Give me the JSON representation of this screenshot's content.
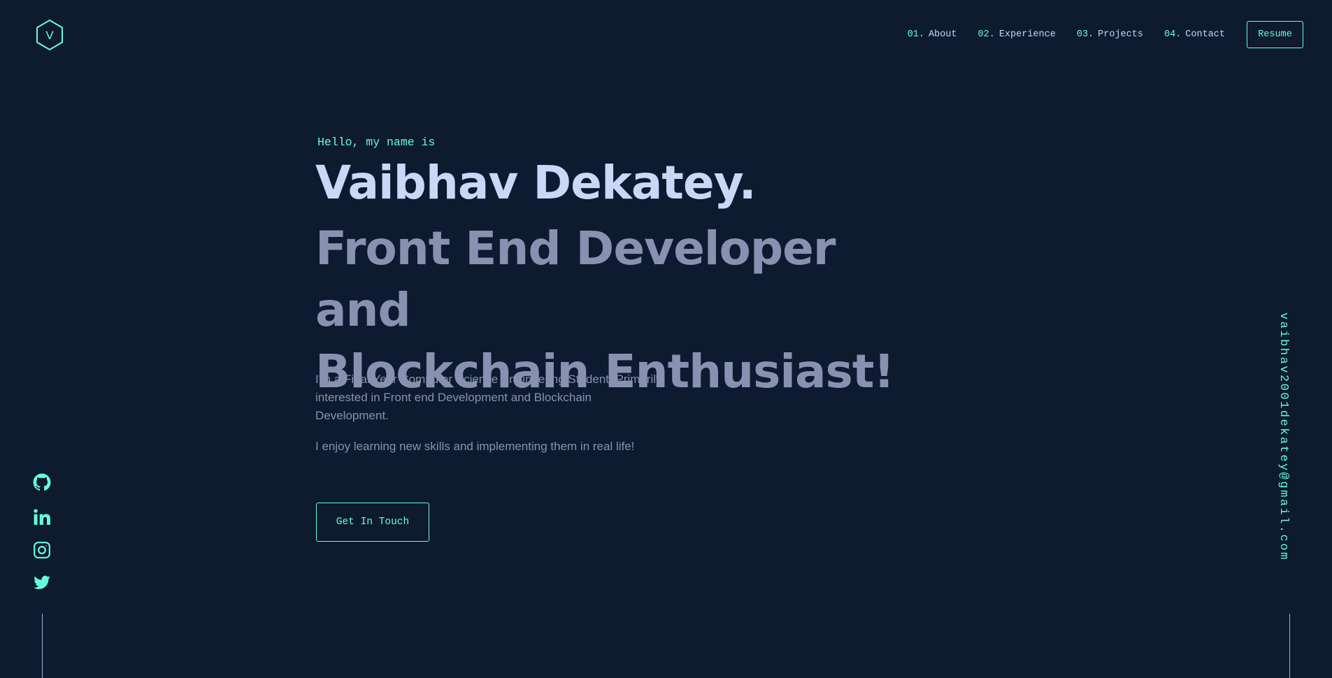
{
  "logo": {
    "letter": "V",
    "icon": "hexagon-logo-icon"
  },
  "nav": {
    "items": [
      {
        "num": "01.",
        "label": "About"
      },
      {
        "num": "02.",
        "label": "Experience"
      },
      {
        "num": "03.",
        "label": "Projects"
      },
      {
        "num": "04.",
        "label": "Contact"
      }
    ],
    "resume_label": "Resume"
  },
  "hero": {
    "greeting": "Hello, my name is",
    "name": "Vaibhav Dekatey.",
    "tagline_line1": "Front End Developer and",
    "tagline_line2": "Blockchain Enthusiast!",
    "bio": "I'm a Final Year Computer Science Engineering Student. Primarily interested in Front end Development and Blockchain Development.",
    "bio2": "I enjoy learning new skills and implementing them in real life!",
    "cta_label": "Get In Touch"
  },
  "socials": [
    "github-icon",
    "linkedin-icon",
    "instagram-icon",
    "twitter-icon"
  ],
  "email": "vaibhav2001dekatey@gmail.com",
  "colors": {
    "background": "#0d1a2f",
    "accent": "#64ffda",
    "heading": "#ccd6f6",
    "text": "#8892b0"
  }
}
